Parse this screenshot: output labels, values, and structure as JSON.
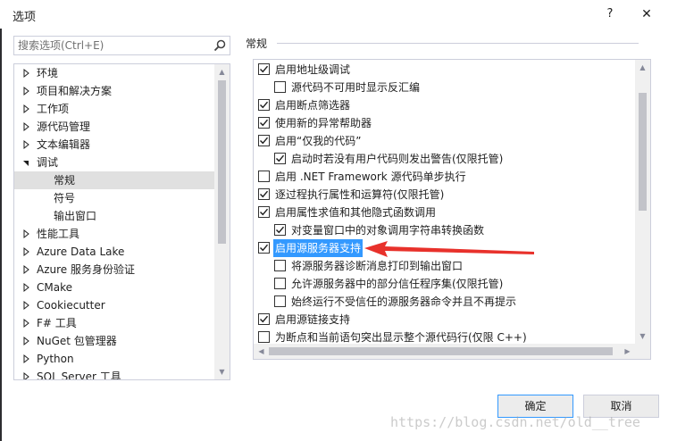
{
  "window": {
    "title": "选项",
    "help_label": "?",
    "close_label": "✕"
  },
  "search": {
    "placeholder": "搜索选项(Ctrl+E)",
    "value": ""
  },
  "tree": {
    "items": [
      {
        "label": "环境",
        "expanded": false,
        "level": 0
      },
      {
        "label": "项目和解决方案",
        "expanded": false,
        "level": 0
      },
      {
        "label": "工作项",
        "expanded": false,
        "level": 0
      },
      {
        "label": "源代码管理",
        "expanded": false,
        "level": 0
      },
      {
        "label": "文本编辑器",
        "expanded": false,
        "level": 0
      },
      {
        "label": "调试",
        "expanded": true,
        "level": 0
      },
      {
        "label": "常规",
        "level": 1,
        "selected": true
      },
      {
        "label": "符号",
        "level": 1
      },
      {
        "label": "输出窗口",
        "level": 1
      },
      {
        "label": "性能工具",
        "expanded": false,
        "level": 0
      },
      {
        "label": "Azure Data Lake",
        "expanded": false,
        "level": 0
      },
      {
        "label": "Azure 服务身份验证",
        "expanded": false,
        "level": 0
      },
      {
        "label": "CMake",
        "expanded": false,
        "level": 0
      },
      {
        "label": "Cookiecutter",
        "expanded": false,
        "level": 0
      },
      {
        "label": "F# 工具",
        "expanded": false,
        "level": 0
      },
      {
        "label": "NuGet 包管理器",
        "expanded": false,
        "level": 0
      },
      {
        "label": "Python",
        "expanded": false,
        "level": 0
      },
      {
        "label": "SQL Server 工具",
        "expanded": false,
        "level": 0
      }
    ]
  },
  "section": {
    "title": "常规"
  },
  "options": [
    {
      "label": "启用地址级调试",
      "checked": true,
      "indent": 0
    },
    {
      "label": "源代码不可用时显示反汇编",
      "checked": false,
      "indent": 1
    },
    {
      "label": "启用断点筛选器",
      "checked": true,
      "indent": 0
    },
    {
      "label": "使用新的异常帮助器",
      "checked": true,
      "indent": 0
    },
    {
      "label": "启用“仅我的代码”",
      "checked": true,
      "indent": 0
    },
    {
      "label": "启动时若没有用户代码则发出警告(仅限托管)",
      "checked": true,
      "indent": 1
    },
    {
      "label": "启用 .NET Framework 源代码单步执行",
      "checked": false,
      "indent": 0
    },
    {
      "label": "逐过程执行属性和运算符(仅限托管)",
      "checked": true,
      "indent": 0
    },
    {
      "label": "启用属性求值和其他隐式函数调用",
      "checked": true,
      "indent": 0
    },
    {
      "label": "对变量窗口中的对象调用字符串转换函数",
      "checked": true,
      "indent": 1
    },
    {
      "label": "启用源服务器支持",
      "checked": true,
      "indent": 0,
      "highlighted": true
    },
    {
      "label": "将源服务器诊断消息打印到输出窗口",
      "checked": false,
      "indent": 1
    },
    {
      "label": "允许源服务器中的部分信任程序集(仅限托管)",
      "checked": false,
      "indent": 1
    },
    {
      "label": "始终运行不受信任的源服务器命令并且不再提示",
      "checked": false,
      "indent": 1
    },
    {
      "label": "启用源链接支持",
      "checked": true,
      "indent": 0
    },
    {
      "label": "为断点和当前语句突出显示整个源代码行(仅限 C++)",
      "checked": false,
      "indent": 0
    }
  ],
  "buttons": {
    "ok_label": "确定",
    "cancel_label": "取消"
  },
  "watermark": "https://blog.csdn.net/old__tree",
  "colors": {
    "accent": "#3399ff",
    "selection": "#e0e0e0",
    "annotation_arrow": "#e8312b"
  },
  "icons": {
    "search": "search-icon",
    "collapsed": "triangle-right-icon",
    "expanded": "triangle-down-icon",
    "checkbox": "check-icon"
  }
}
